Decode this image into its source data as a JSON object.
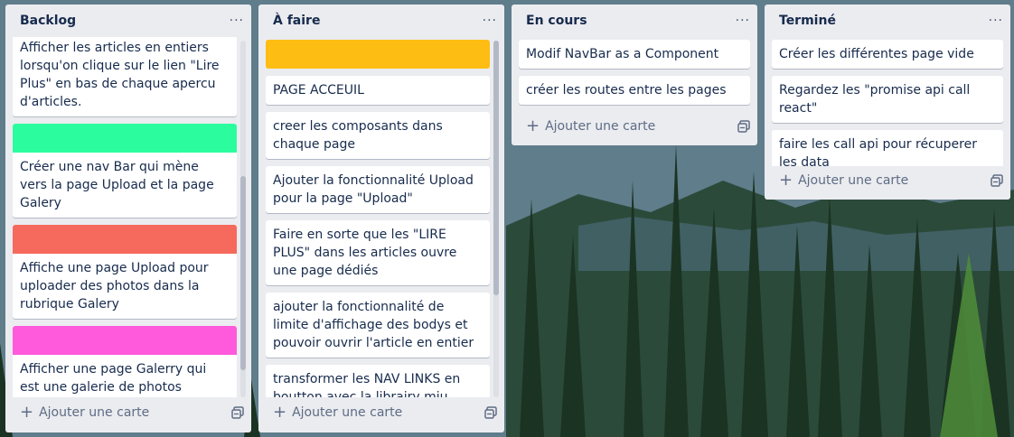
{
  "board": {
    "lists": [
      {
        "title": "Backlog",
        "menu": "···",
        "cards": [
          {
            "text": "Afficher les articles en entiers lorsqu'on clique sur le lien \"Lire Plus\" en bas de chaque apercu d'articles."
          },
          {
            "label_color": "#2bfd9f",
            "text": "Créer une nav Bar qui mène vers la page Upload et la page Galery"
          },
          {
            "label_color": "#f56a5c",
            "text": "Affiche une page Upload pour uploader des photos dans la rubrique Galery"
          },
          {
            "label_color": "#ff5adb",
            "text": "Afficher une page Galerry qui est une galerie de photos"
          }
        ],
        "add_label": "Ajouter une carte"
      },
      {
        "title": "À faire",
        "menu": "···",
        "cover_color": "#fdbd12",
        "cards": [
          {
            "text": "PAGE ACCEUIL"
          },
          {
            "text": "creer les composants dans chaque page"
          },
          {
            "text": "Ajouter la fonctionnalité Upload pour la page \"Upload\""
          },
          {
            "text": "Faire en sorte que les \"LIRE PLUS\" dans les articles ouvre une page dédiés"
          },
          {
            "text": "ajouter la fonctionnalité de limite d'affichage des bodys et pouvoir ouvrir l'article en entier"
          },
          {
            "text": "transformer les NAV LINKS en boutton avec la librairy miu"
          }
        ],
        "add_label": "Ajouter une carte"
      },
      {
        "title": "En cours",
        "menu": "···",
        "cards": [
          {
            "text": "Modif NavBar as a Component"
          },
          {
            "text": "créer les routes entre les pages"
          }
        ],
        "add_label": "Ajouter une carte"
      },
      {
        "title": "Terminé",
        "menu": "···",
        "cards": [
          {
            "text": "Créer les différentes page vide"
          },
          {
            "text": "Regardez les \"promise api call react\""
          },
          {
            "text": "faire les call api pour récuperer les data Articles/post/comment/etc"
          }
        ],
        "add_label": "Ajouter une carte"
      }
    ]
  }
}
